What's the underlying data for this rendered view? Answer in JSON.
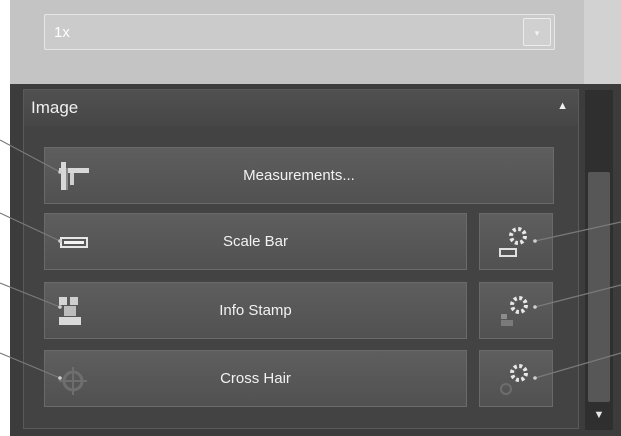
{
  "zoom": {
    "value": "1x",
    "arrow": "▾"
  },
  "group": {
    "title": "Image",
    "collapse_glyph": "▲"
  },
  "buttons": {
    "measurements": "Measurements...",
    "scale_bar": "Scale Bar",
    "info_stamp": "Info Stamp",
    "cross_hair": "Cross Hair"
  },
  "scrollbar": {
    "down_glyph": "▼"
  },
  "icons": {
    "measurements": "caliper-icon",
    "scale_bar": "scale-bar-icon",
    "info_stamp": "info-stamp-icon",
    "cross_hair": "crosshair-icon",
    "settings": "gear-icon"
  }
}
